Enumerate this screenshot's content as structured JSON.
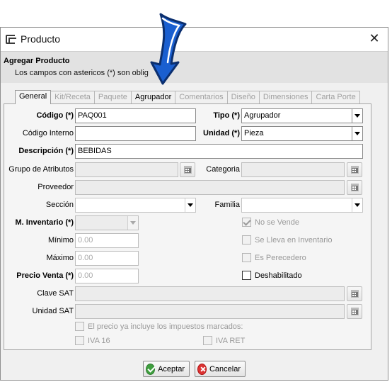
{
  "window": {
    "title": "Producto"
  },
  "header": {
    "title": "Agregar Producto",
    "subtitle": "Los campos con astericos (*) son oblig"
  },
  "tabs": [
    {
      "label": "General"
    },
    {
      "label": "Kit/Receta"
    },
    {
      "label": "Paquete"
    },
    {
      "label": "Agrupador"
    },
    {
      "label": "Comentarios"
    },
    {
      "label": "Diseño"
    },
    {
      "label": "Dimensiones"
    },
    {
      "label": "Carta Porte"
    }
  ],
  "form": {
    "codigo": {
      "label": "Código (*)",
      "value": "PAQ001"
    },
    "codigo_interno": {
      "label": "Código Interno",
      "value": ""
    },
    "tipo": {
      "label": "Tipo (*)",
      "value": "Agrupador"
    },
    "unidad": {
      "label": "Unidad (*)",
      "value": "Pieza"
    },
    "descripcion": {
      "label": "Descripción (*)",
      "value": "BEBIDAS"
    },
    "grupo_atributos": {
      "label": "Grupo de Atributos",
      "value": ""
    },
    "categoria": {
      "label": "Categoria",
      "value": ""
    },
    "proveedor": {
      "label": "Proveedor",
      "value": ""
    },
    "seccion": {
      "label": "Sección",
      "value": ""
    },
    "familia": {
      "label": "Familia",
      "value": ""
    },
    "m_inventario": {
      "label": "M. Inventario (*)",
      "value": ""
    },
    "minimo": {
      "label": "Mínimo",
      "placeholder": "0.00"
    },
    "maximo": {
      "label": "Máximo",
      "placeholder": "0.00"
    },
    "precio_venta": {
      "label": "Precio Venta (*)",
      "placeholder": "0.00"
    },
    "clave_sat": {
      "label": "Clave SAT",
      "value": ""
    },
    "unidad_sat": {
      "label": "Unidad SAT",
      "value": ""
    }
  },
  "checks": {
    "no_se_vende": {
      "label": "No se Vende",
      "checked": true
    },
    "se_lleva_inventario": {
      "label": "Se Lleva en Inventario",
      "checked": false
    },
    "es_perecedero": {
      "label": "Es Perecedero",
      "checked": false
    },
    "deshabilitado": {
      "label": "Deshabilitado",
      "checked": false
    },
    "precio_incluye": {
      "label": "El precio ya incluye los impuestos marcados:",
      "checked": false
    },
    "iva16": {
      "label": "IVA 16",
      "checked": false
    },
    "iva_ret": {
      "label": "IVA RET",
      "checked": false
    }
  },
  "buttons": {
    "accept": "Aceptar",
    "cancel": "Cancelar"
  },
  "colors": {
    "accept_icon": "#3f9f3f",
    "cancel_icon": "#dd3333",
    "arrow": "#1a5fd0"
  }
}
